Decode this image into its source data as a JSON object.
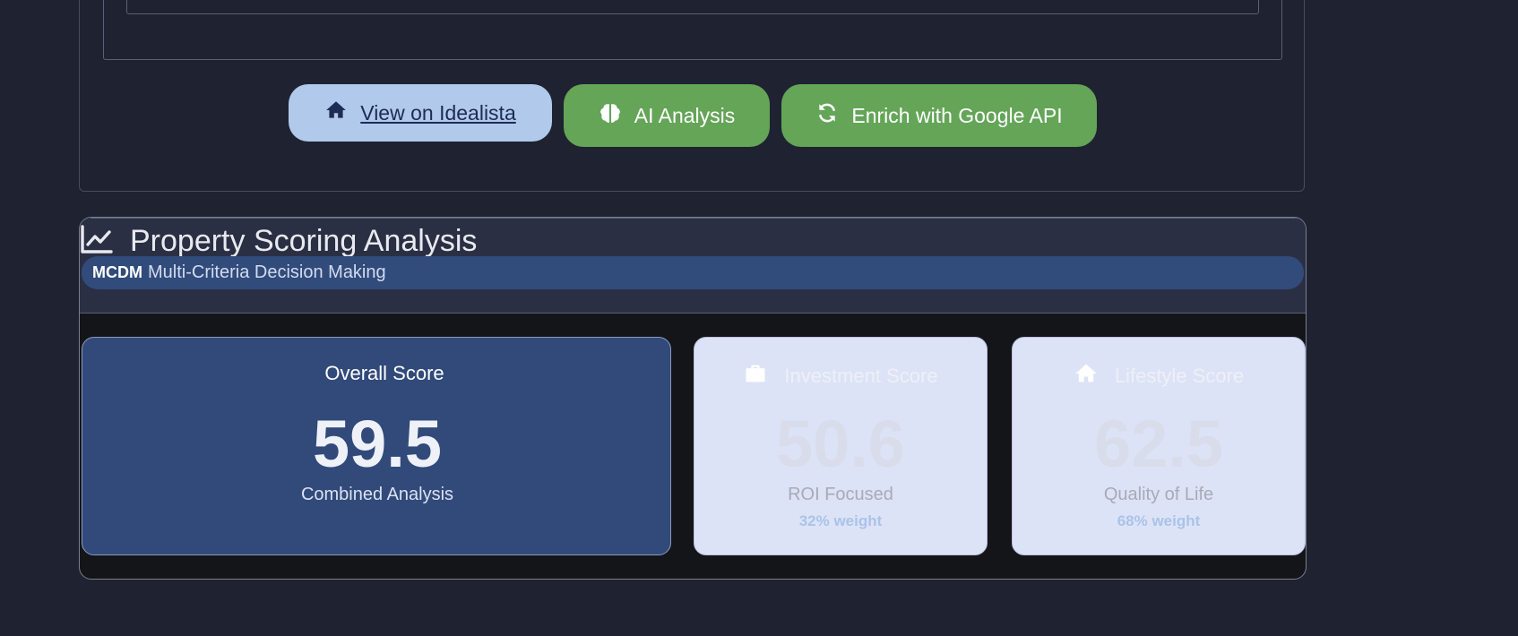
{
  "actions": {
    "idealista_label": "View on Idealista",
    "ai_label": "AI Analysis",
    "google_label": "Enrich with Google API"
  },
  "scoring": {
    "title": "Property Scoring Analysis",
    "mcdm_tag": "MCDM",
    "mcdm_text": "Multi-Criteria Decision Making",
    "overall": {
      "label": "Overall Score",
      "value": "59.5",
      "subtitle": "Combined Analysis"
    },
    "investment": {
      "label": "Investment Score",
      "value": "50.6",
      "subtitle": "ROI Focused",
      "weight": "32% weight",
      "icon": "briefcase-icon"
    },
    "lifestyle": {
      "label": "Lifestyle Score",
      "value": "62.5",
      "subtitle": "Quality of Life",
      "weight": "68% weight",
      "icon": "home-icon"
    }
  },
  "colors": {
    "page_bg": "#1f2231",
    "accent_green": "#64a558",
    "idealista_blue": "#b1c9ea",
    "overall_card": "#314a7a",
    "light_card": "#dde3f6"
  }
}
